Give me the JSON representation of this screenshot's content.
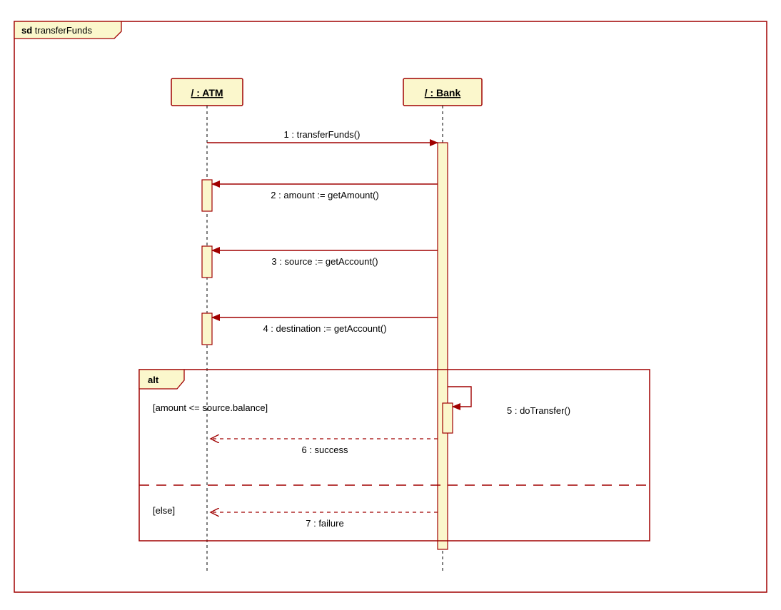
{
  "frame": {
    "label_prefix": "sd",
    "label_name": "transferFunds",
    "alt_label": "alt",
    "guard1": "[amount <= source.balance]",
    "guard2": "[else]"
  },
  "lifelines": {
    "atm": "/ : ATM",
    "bank": "/ : Bank"
  },
  "messages": {
    "m1": "1 : transferFunds()",
    "m2": "2 : amount := getAmount()",
    "m3": "3 : source := getAccount()",
    "m4": "4 : destination := getAccount()",
    "m5": "5 : doTransfer()",
    "m6": "6 : success",
    "m7": "7 : failure"
  }
}
